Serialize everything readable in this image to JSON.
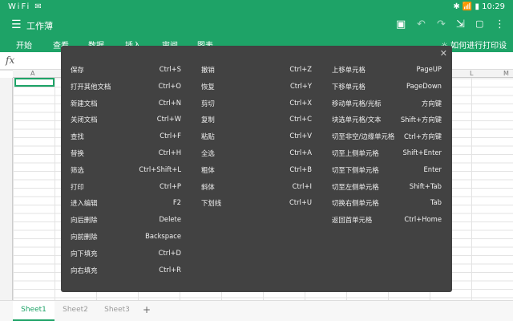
{
  "status": {
    "left": "WiFi ✉",
    "right": "✱ 📶 ▮ 10:29"
  },
  "app": {
    "title": "工作薄"
  },
  "ribbon": {
    "tabs": [
      "开始",
      "查看",
      "数据",
      "插入",
      "审阅",
      "图表"
    ],
    "help": "如何进行打印设置"
  },
  "formula": {
    "fx": "fx"
  },
  "columns": [
    "A",
    "L",
    "M"
  ],
  "sheets": {
    "tabs": [
      "Sheet1",
      "Sheet2",
      "Sheet3"
    ],
    "active": "Sheet1",
    "add": "+"
  },
  "shortcuts": {
    "col1": [
      {
        "name": "保存",
        "key": "Ctrl+S"
      },
      {
        "name": "打开其他文档",
        "key": "Ctrl+O"
      },
      {
        "name": "新建文档",
        "key": "Ctrl+N"
      },
      {
        "name": "关闭文档",
        "key": "Ctrl+W"
      },
      {
        "name": "查找",
        "key": "Ctrl+F"
      },
      {
        "name": "替换",
        "key": "Ctrl+H"
      },
      {
        "name": "筛选",
        "key": "Ctrl+Shift+L"
      },
      {
        "name": "打印",
        "key": "Ctrl+P"
      },
      {
        "name": "进入编辑",
        "key": "F2"
      },
      {
        "name": "向后删除",
        "key": "Delete"
      },
      {
        "name": "向前删除",
        "key": "Backspace"
      },
      {
        "name": "向下填充",
        "key": "Ctrl+D"
      },
      {
        "name": "向右填充",
        "key": "Ctrl+R"
      }
    ],
    "col2": [
      {
        "name": "撤销",
        "key": "Ctrl+Z"
      },
      {
        "name": "恢复",
        "key": "Ctrl+Y"
      },
      {
        "name": "剪切",
        "key": "Ctrl+X"
      },
      {
        "name": "复制",
        "key": "Ctrl+C"
      },
      {
        "name": "粘贴",
        "key": "Ctrl+V"
      },
      {
        "name": "全选",
        "key": "Ctrl+A"
      },
      {
        "name": "粗体",
        "key": "Ctrl+B"
      },
      {
        "name": "斜体",
        "key": "Ctrl+I"
      },
      {
        "name": "下划线",
        "key": "Ctrl+U"
      }
    ],
    "col3": [
      {
        "name": "上移单元格",
        "key": "PageUP"
      },
      {
        "name": "下移单元格",
        "key": "PageDown"
      },
      {
        "name": "移动单元格/光标",
        "key": "方向键"
      },
      {
        "name": "块选单元格/文本",
        "key": "Shift+方向键"
      },
      {
        "name": "切至非空/边缘单元格",
        "key": "Ctrl+方向键"
      },
      {
        "name": "切至上侧单元格",
        "key": "Shift+Enter"
      },
      {
        "name": "切至下侧单元格",
        "key": "Enter"
      },
      {
        "name": "切至左侧单元格",
        "key": "Shift+Tab"
      },
      {
        "name": "切换右侧单元格",
        "key": "Tab"
      },
      {
        "name": "返回首单元格",
        "key": "Ctrl+Home"
      }
    ]
  }
}
